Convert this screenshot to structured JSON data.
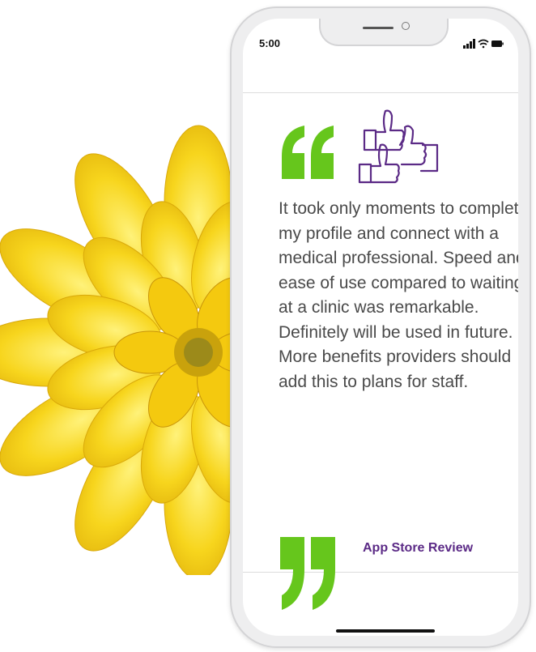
{
  "status_bar": {
    "time": "5:00",
    "icons": [
      "signal-icon",
      "wifi-icon",
      "battery-icon"
    ]
  },
  "review": {
    "text": "It took only moments to complete my profile and connect with a medical professional. Speed and ease of use compared to waiting at a clinic was remarkable. Definitely will be used in future. More benefits providers should add this to plans for staff.",
    "source": "App Store Review"
  },
  "colors": {
    "quote_green": "#66c61c",
    "accent_purple": "#5b2a86",
    "text_gray": "#4a4a4a",
    "flower_yellow": "#f7d51d"
  },
  "decor": {
    "flower": "yellow-dahlia-image",
    "header_icon": "thumbs-up-icon"
  }
}
